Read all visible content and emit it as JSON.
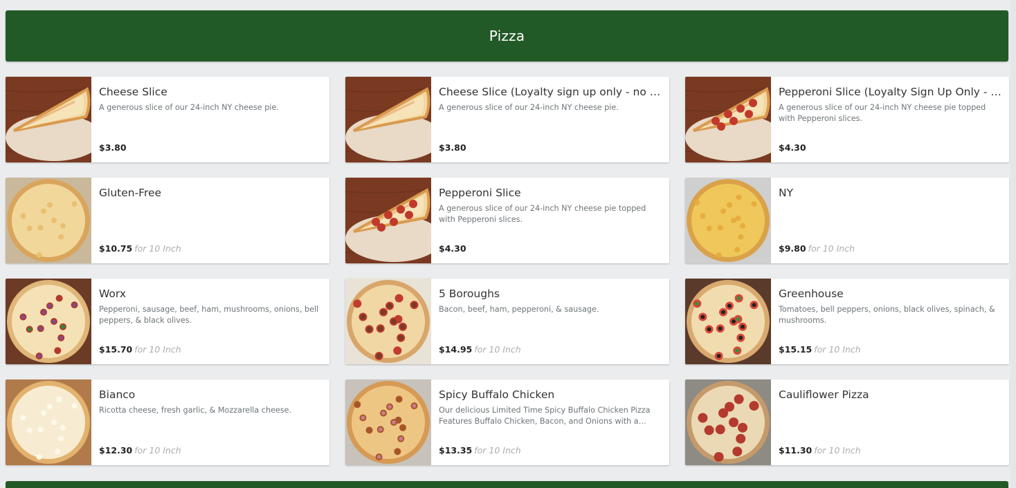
{
  "section": {
    "title": "Pizza"
  },
  "items": [
    {
      "name": "Cheese Slice",
      "description": "A generous slice of our 24-inch NY cheese pie.",
      "price": "$3.80",
      "size": "",
      "image": "cheese-slice"
    },
    {
      "name": "Cheese Slice (Loyalty sign up only - no extra toppings)",
      "description": "A generous slice of our 24-inch NY cheese pie.",
      "price": "$3.80",
      "size": "",
      "image": "cheese-slice"
    },
    {
      "name": "Pepperoni Slice (Loyalty Sign Up Only - no extra toppings)",
      "description": "A generous slice of our 24-inch NY cheese pie topped with Pepperoni slices.",
      "price": "$4.30",
      "size": "",
      "image": "pepperoni-slice"
    },
    {
      "name": "Gluten-Free",
      "description": "",
      "price": "$10.75",
      "size": "for 10 Inch",
      "image": "cheese-pie"
    },
    {
      "name": "Pepperoni Slice",
      "description": "A generous slice of our 24-inch NY cheese pie topped with Pepperoni slices.",
      "price": "$4.30",
      "size": "",
      "image": "pepperoni-slice"
    },
    {
      "name": "NY",
      "description": "",
      "price": "$9.80",
      "size": "for 10 Inch",
      "image": "ny-pie"
    },
    {
      "name": "Worx",
      "description": "Pepperoni, sausage, beef, ham, mushrooms, onions, bell peppers, & black olives.",
      "price": "$15.70",
      "size": "for 10 Inch",
      "image": "worx-pie"
    },
    {
      "name": "5 Boroughs",
      "description": "Bacon, beef, ham, pepperoni, & sausage.",
      "price": "$14.95",
      "size": "for 10 Inch",
      "image": "meat-pie"
    },
    {
      "name": "Greenhouse",
      "description": "Tomatoes, bell peppers, onions, black olives, spinach, & mushrooms.",
      "price": "$15.15",
      "size": "for 10 Inch",
      "image": "veggie-pie"
    },
    {
      "name": "Bianco",
      "description": "Ricotta cheese, fresh garlic, & Mozzarella cheese.",
      "price": "$12.30",
      "size": "for 10 Inch",
      "image": "white-pie"
    },
    {
      "name": "Spicy Buffalo Chicken",
      "description": "Our delicious Limited Time Spicy Buffalo Chicken Pizza Features Buffalo Chicken, Bacon, and Onions with a Buffalo sauce base.",
      "price": "$13.35",
      "size": "for 10 Inch",
      "image": "buffalo-pie"
    },
    {
      "name": "Cauliflower Pizza",
      "description": "",
      "price": "$11.30",
      "size": "for 10 Inch",
      "image": "cauliflower-pie"
    }
  ],
  "colors": {
    "header": "#225a27",
    "background": "#ebeced",
    "card": "#ffffff"
  }
}
